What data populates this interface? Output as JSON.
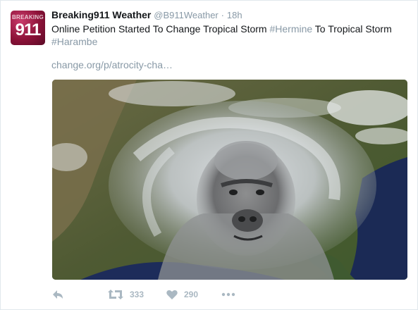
{
  "tweet": {
    "avatar": {
      "top_text": "BREAKING",
      "number": "911"
    },
    "display_name": "Breaking911 Weather",
    "handle": "@B911Weather",
    "separator": "·",
    "time": "18h",
    "text_part1": "Online Petition Started To Change Tropical Storm ",
    "hashtag1": "#Hermine",
    "text_part2": " To Tropical Storm ",
    "hashtag2": "#Harambe",
    "link": "change.org/p/atrocity-cha…",
    "actions": {
      "retweets": "333",
      "likes": "290"
    }
  },
  "icons": {
    "reply": "reply-icon",
    "retweet": "retweet-icon",
    "like": "heart-icon",
    "more": "more-dots-icon"
  },
  "colors": {
    "meta_text": "#8899a6",
    "action_icon": "#aab8c2",
    "border": "#e1e8ed"
  }
}
